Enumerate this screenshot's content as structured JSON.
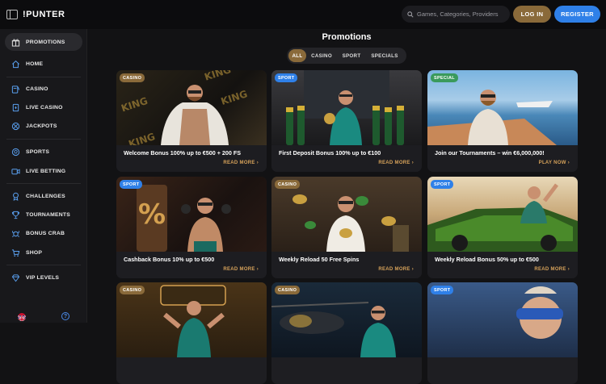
{
  "header": {
    "logo": "!PUNTER",
    "search_placeholder": "Games, Categories, Providers",
    "login_label": "LOG IN",
    "register_label": "REGISTER"
  },
  "sidebar": {
    "items": [
      {
        "label": "PROMOTIONS",
        "icon": "gift-icon"
      },
      {
        "label": "HOME",
        "icon": "home-icon"
      },
      {
        "label": "CASINO",
        "icon": "slot-icon"
      },
      {
        "label": "LIVE CASINO",
        "icon": "cards-icon"
      },
      {
        "label": "JACKPOTS",
        "icon": "chip-icon"
      },
      {
        "label": "SPORTS",
        "icon": "football-icon"
      },
      {
        "label": "LIVE BETTING",
        "icon": "live-tv-icon"
      },
      {
        "label": "CHALLENGES",
        "icon": "trophy-icon"
      },
      {
        "label": "TOURNAMENTS",
        "icon": "cup-icon"
      },
      {
        "label": "BONUS CRAB",
        "icon": "crab-icon"
      },
      {
        "label": "SHOP",
        "icon": "cart-icon"
      },
      {
        "label": "VIP LEVELS",
        "icon": "diamond-icon"
      }
    ],
    "help_label": "?"
  },
  "main": {
    "title": "Promotions",
    "filters": [
      "ALL",
      "CASINO",
      "SPORT",
      "SPECIALS"
    ],
    "cards": [
      {
        "badge": "CASINO",
        "title": "Welcome Bonus 100% up to €500 + 200 FS",
        "cta": "READ MORE  ›"
      },
      {
        "badge": "SPORT",
        "title": "First Deposit Bonus 100% up to €100",
        "cta": "READ MORE  ›"
      },
      {
        "badge": "SPECIAL",
        "title": "Join our Tournaments – win €6,000,000!",
        "cta": "PLAY NOW  ›"
      },
      {
        "badge": "SPORT",
        "title": "Cashback Bonus 10% up to €500",
        "cta": "READ MORE  ›"
      },
      {
        "badge": "CASINO",
        "title": "Weekly Reload 50 Free Spins",
        "cta": "READ MORE  ›"
      },
      {
        "badge": "SPORT",
        "title": "Weekly Reload Bonus 50% up to €500",
        "cta": "READ MORE  ›"
      },
      {
        "badge": "CASINO"
      },
      {
        "badge": "CASINO"
      },
      {
        "badge": "SPORT"
      }
    ]
  },
  "colors": {
    "accent_gold": "#8a6a3a",
    "accent_blue": "#2f80e8",
    "link_gold": "#d6a25a",
    "background": "#121214"
  }
}
